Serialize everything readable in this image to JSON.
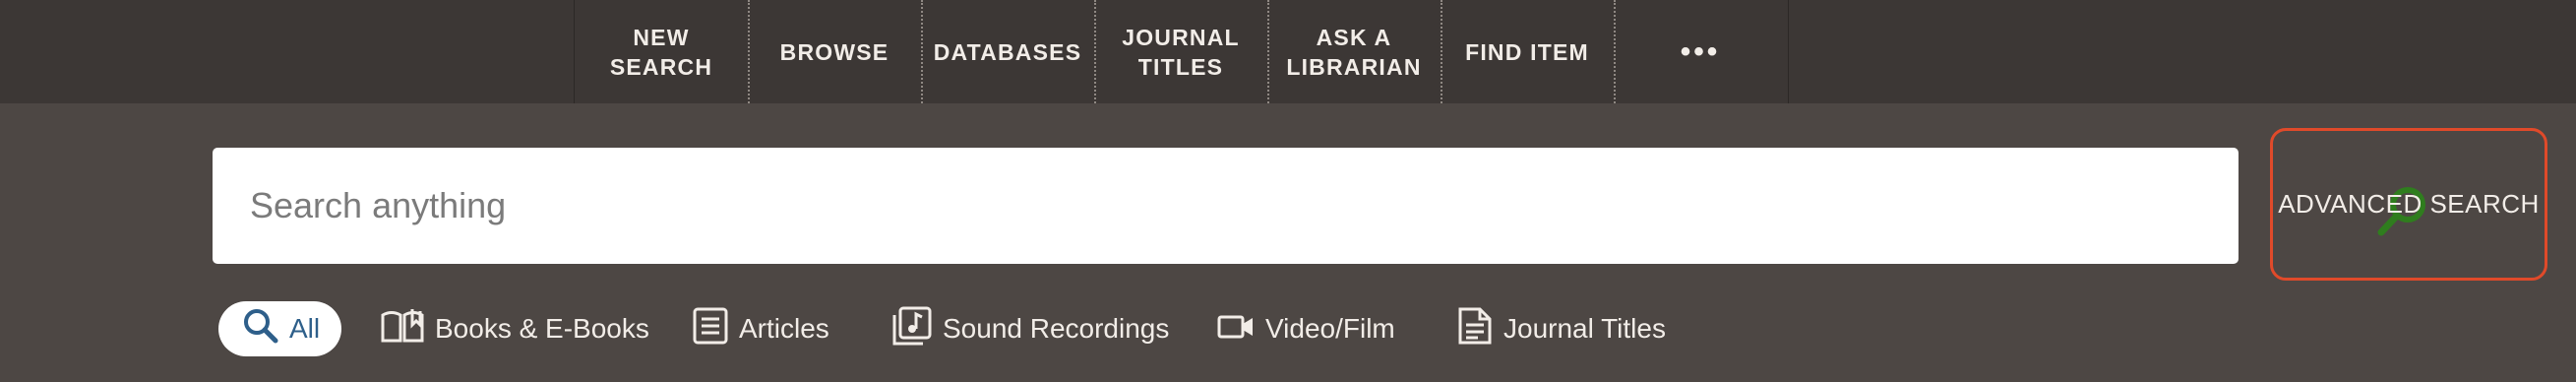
{
  "nav": {
    "items": [
      {
        "label": "NEW\nSEARCH"
      },
      {
        "label": "BROWSE"
      },
      {
        "label": "DATABASES"
      },
      {
        "label": "JOURNAL\nTITLES"
      },
      {
        "label": "ASK A\nLIBRARIAN"
      },
      {
        "label": "FIND ITEM"
      }
    ],
    "more_label": "•••"
  },
  "search": {
    "placeholder": "Search anything",
    "value": "",
    "icon": "magnifier-icon"
  },
  "advanced_search": {
    "label": "ADVANCED SEARCH"
  },
  "filters": [
    {
      "label": "All",
      "icon": "search-icon",
      "selected": true
    },
    {
      "label": "Books & E-Books",
      "icon": "book-icon",
      "selected": false
    },
    {
      "label": "Articles",
      "icon": "article-icon",
      "selected": false
    },
    {
      "label": "Sound Recordings",
      "icon": "music-note-icon",
      "selected": false
    },
    {
      "label": "Video/Film",
      "icon": "video-camera-icon",
      "selected": false
    },
    {
      "label": "Journal Titles",
      "icon": "journal-icon",
      "selected": false
    }
  ],
  "colors": {
    "topbar": "#3c3735",
    "background": "#4d4744",
    "accent_green": "#2f7d1e",
    "advanced_border": "#e04a2a",
    "selected_text": "#2e5f8a"
  }
}
